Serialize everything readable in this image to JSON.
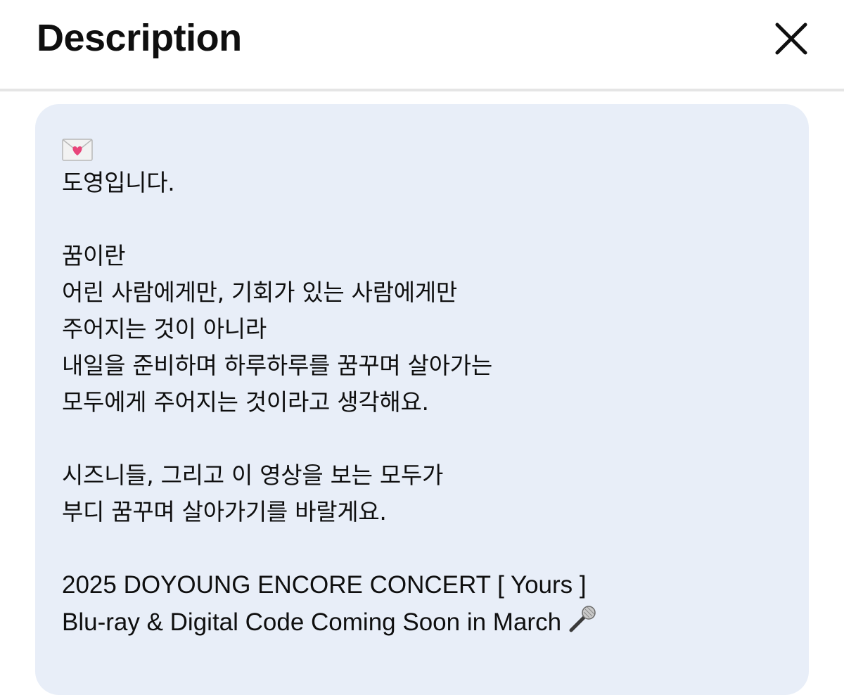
{
  "header": {
    "title": "Description",
    "close_icon": "close-icon"
  },
  "description": {
    "leading_emoji": "love-letter-icon",
    "lines": [
      "도영입니다.",
      "꿈이란",
      "어린 사람에게만, 기회가 있는 사람에게만",
      "주어지는 것이 아니라",
      "내일을 준비하며 하루하루를 꿈꾸며 살아가는",
      "모두에게 주어지는 것이라고 생각해요.",
      "시즈니들, 그리고 이 영상을 보는 모두가",
      "부디 꿈꾸며 살아가기를 바랄게요.",
      "2025 DOYOUNG ENCORE CONCERT [ Yours ]",
      "Blu-ray & Digital Code Coming Soon in March"
    ],
    "trailing_emoji": "microphone-icon"
  },
  "colors": {
    "card_background": "#e8eef8",
    "divider": "#e5e5e5",
    "text": "#0f0f0f"
  }
}
